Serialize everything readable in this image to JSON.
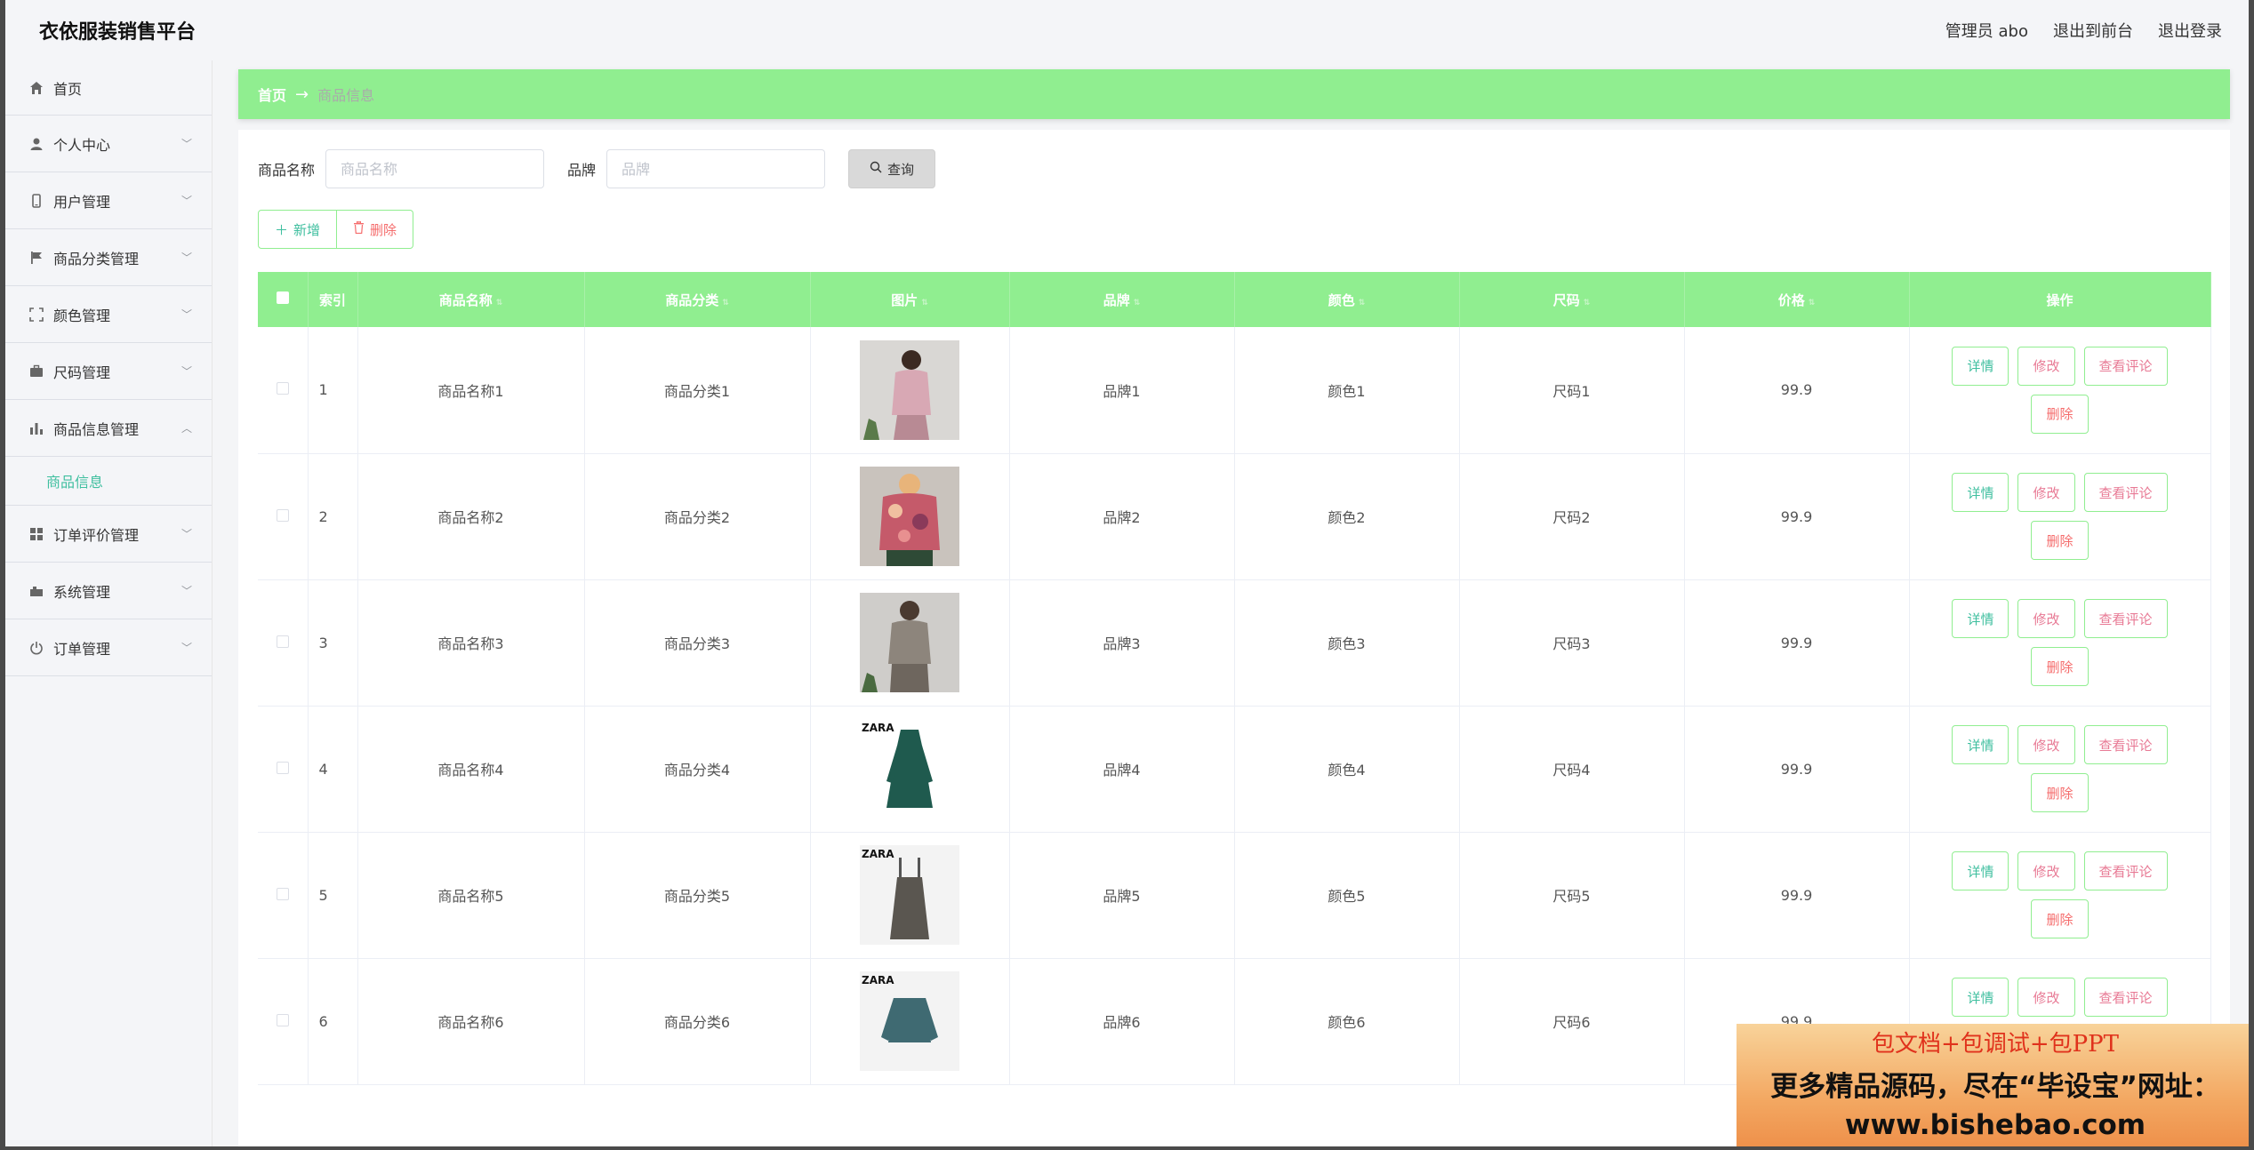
{
  "app": {
    "title": "衣依服装销售平台",
    "admin_label": "管理员 abo",
    "to_front": "退出到前台",
    "logout": "退出登录"
  },
  "sidebar": {
    "items": [
      {
        "label": "首页",
        "icon": "home-icon"
      },
      {
        "label": "个人中心",
        "icon": "user-icon"
      },
      {
        "label": "用户管理",
        "icon": "phone-icon"
      },
      {
        "label": "商品分类管理",
        "icon": "flag-icon"
      },
      {
        "label": "颜色管理",
        "icon": "crop-icon"
      },
      {
        "label": "尺码管理",
        "icon": "briefcase-icon"
      },
      {
        "label": "商品信息管理",
        "icon": "bar-chart-icon"
      },
      {
        "label": "订单评价管理",
        "icon": "grid-icon"
      },
      {
        "label": "系统管理",
        "icon": "toolbox-icon"
      },
      {
        "label": "订单管理",
        "icon": "power-icon"
      }
    ],
    "submenu_label": "商品信息"
  },
  "breadcrumb": {
    "home": "首页",
    "current": "商品信息"
  },
  "search": {
    "name_label": "商品名称",
    "name_placeholder": "商品名称",
    "brand_label": "品牌",
    "brand_placeholder": "品牌",
    "query_label": "查询"
  },
  "actions": {
    "add_label": "新增",
    "delete_label": "删除"
  },
  "table": {
    "headers": [
      "索引",
      "商品名称",
      "商品分类",
      "图片",
      "品牌",
      "颜色",
      "尺码",
      "价格",
      "操作"
    ],
    "rows": [
      {
        "index": "1",
        "name": "商品名称1",
        "category": "商品分类1",
        "brand": "品牌1",
        "color": "颜色1",
        "size": "尺码1",
        "price": "99.9"
      },
      {
        "index": "2",
        "name": "商品名称2",
        "category": "商品分类2",
        "brand": "品牌2",
        "color": "颜色2",
        "size": "尺码2",
        "price": "99.9"
      },
      {
        "index": "3",
        "name": "商品名称3",
        "category": "商品分类3",
        "brand": "品牌3",
        "color": "颜色3",
        "size": "尺码3",
        "price": "99.9"
      },
      {
        "index": "4",
        "name": "商品名称4",
        "category": "商品分类4",
        "brand": "品牌4",
        "color": "颜色4",
        "size": "尺码4",
        "price": "99.9"
      },
      {
        "index": "5",
        "name": "商品名称5",
        "category": "商品分类5",
        "brand": "品牌5",
        "color": "颜色5",
        "size": "尺码5",
        "price": "99.9"
      },
      {
        "index": "6",
        "name": "商品名称6",
        "category": "商品分类6",
        "brand": "品牌6",
        "color": "颜色6",
        "size": "尺码6",
        "price": "99.9"
      }
    ],
    "op_detail": "详情",
    "op_edit": "修改",
    "op_review": "查看评论",
    "op_delete": "删除"
  },
  "ad": {
    "line1": "包文档+包调试+包PPT",
    "line2": "更多精品源码，尽在“毕设宝”网址：",
    "line3": "www.bishebao.com"
  }
}
